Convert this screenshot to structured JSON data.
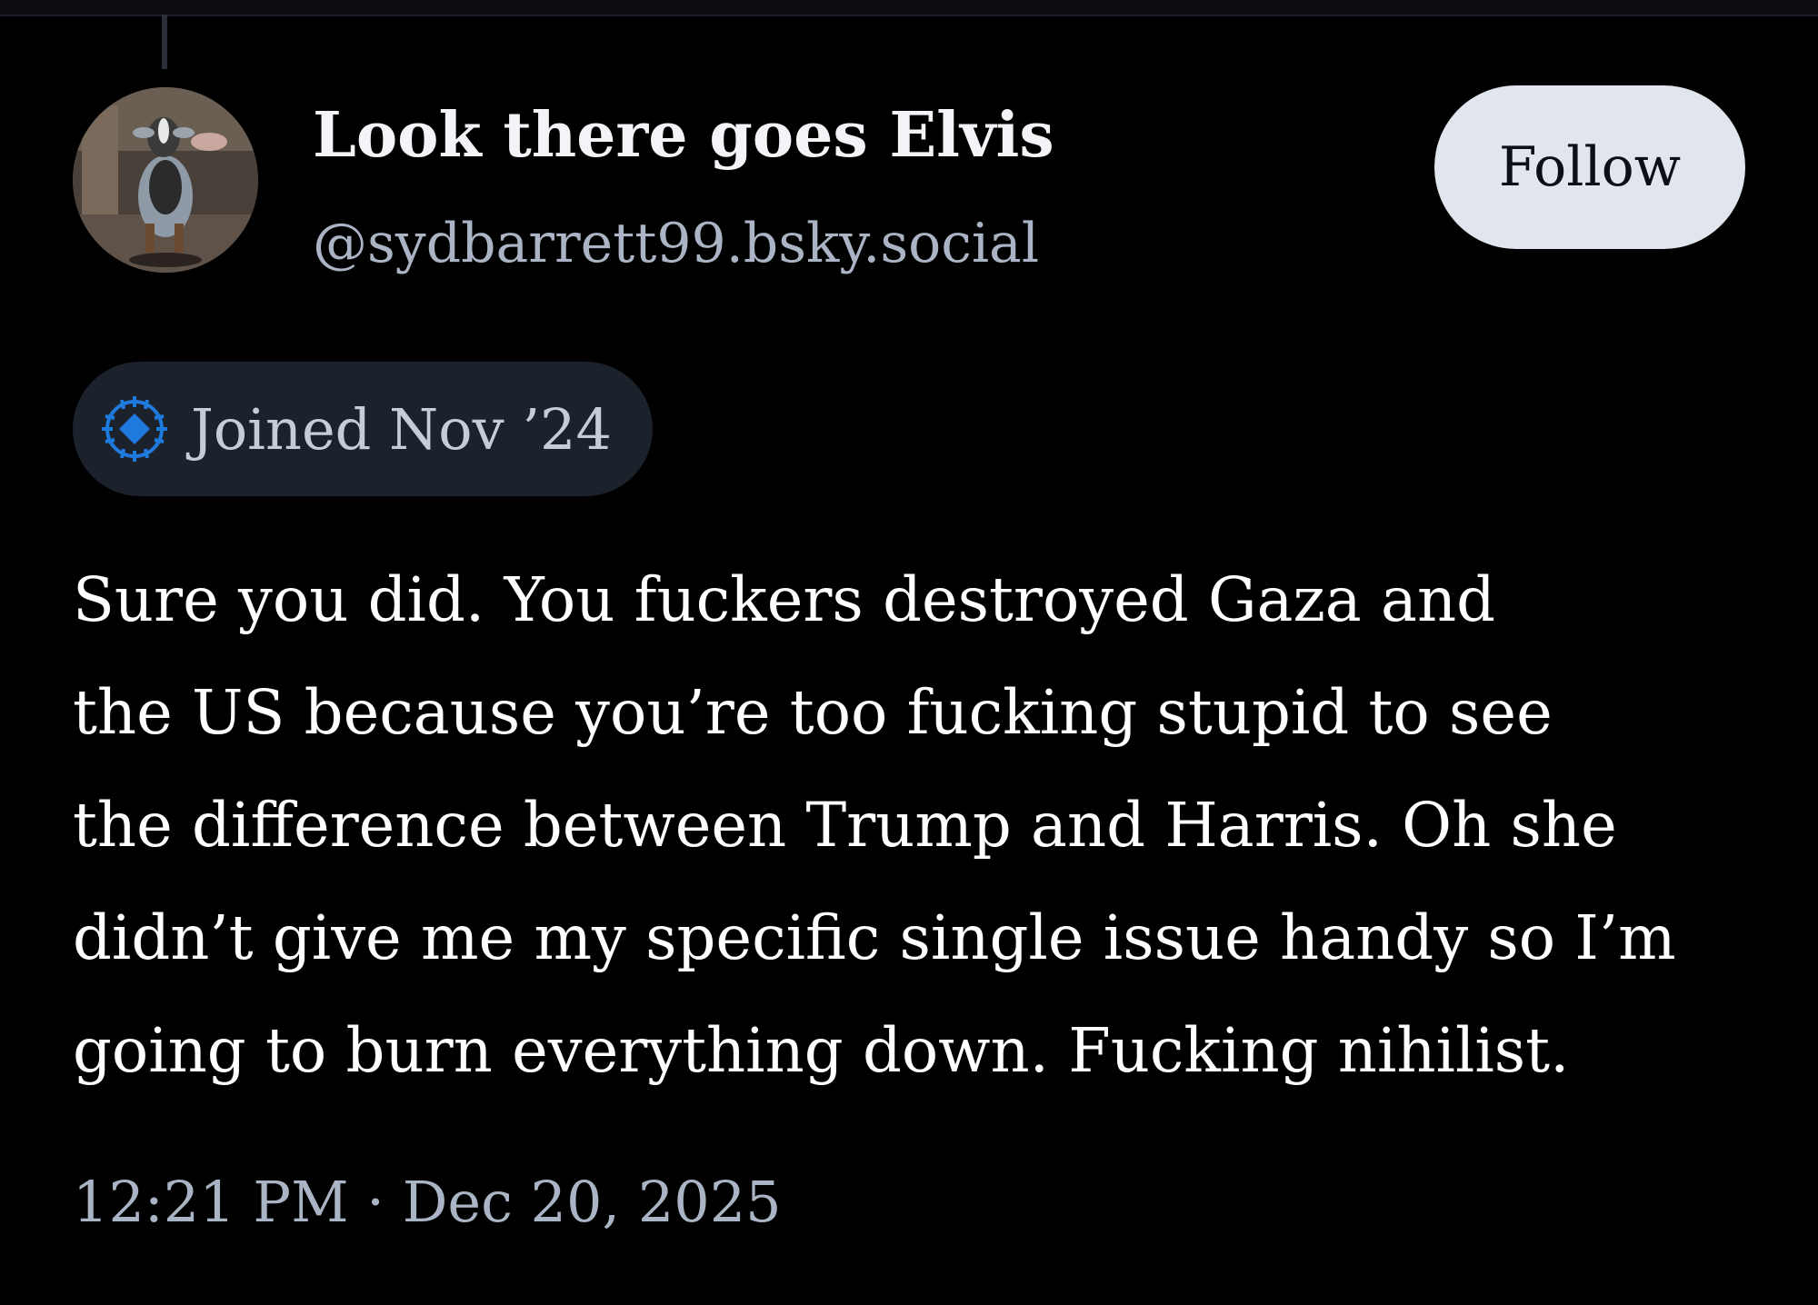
{
  "post": {
    "author": {
      "display_name": "Look there goes Elvis",
      "handle": "@sydbarrett99.bsky.social",
      "avatar": "goat-avatar"
    },
    "follow_label": "Follow",
    "joined_badge": {
      "icon": "new-account-badge-icon",
      "text": "Joined Nov ’24"
    },
    "body_lines": [
      "Sure you did. You fuckers destroyed Gaza and",
      "the US because you’re too fucking stupid to see",
      "the difference between Trump and Harris. Oh she",
      "didn’t give me my specific single issue handy so I’m",
      "going to burn everything down. Fucking nihilist."
    ],
    "timestamp": "12:21 PM · Dec 20, 2025"
  },
  "colors": {
    "background": "#000000",
    "primary_text": "#ffffff",
    "secondary_text": "#aab4c4",
    "follow_button_bg": "#e1e6ee",
    "badge_bg": "#1c222c",
    "badge_icon": "#1f7ae0"
  }
}
